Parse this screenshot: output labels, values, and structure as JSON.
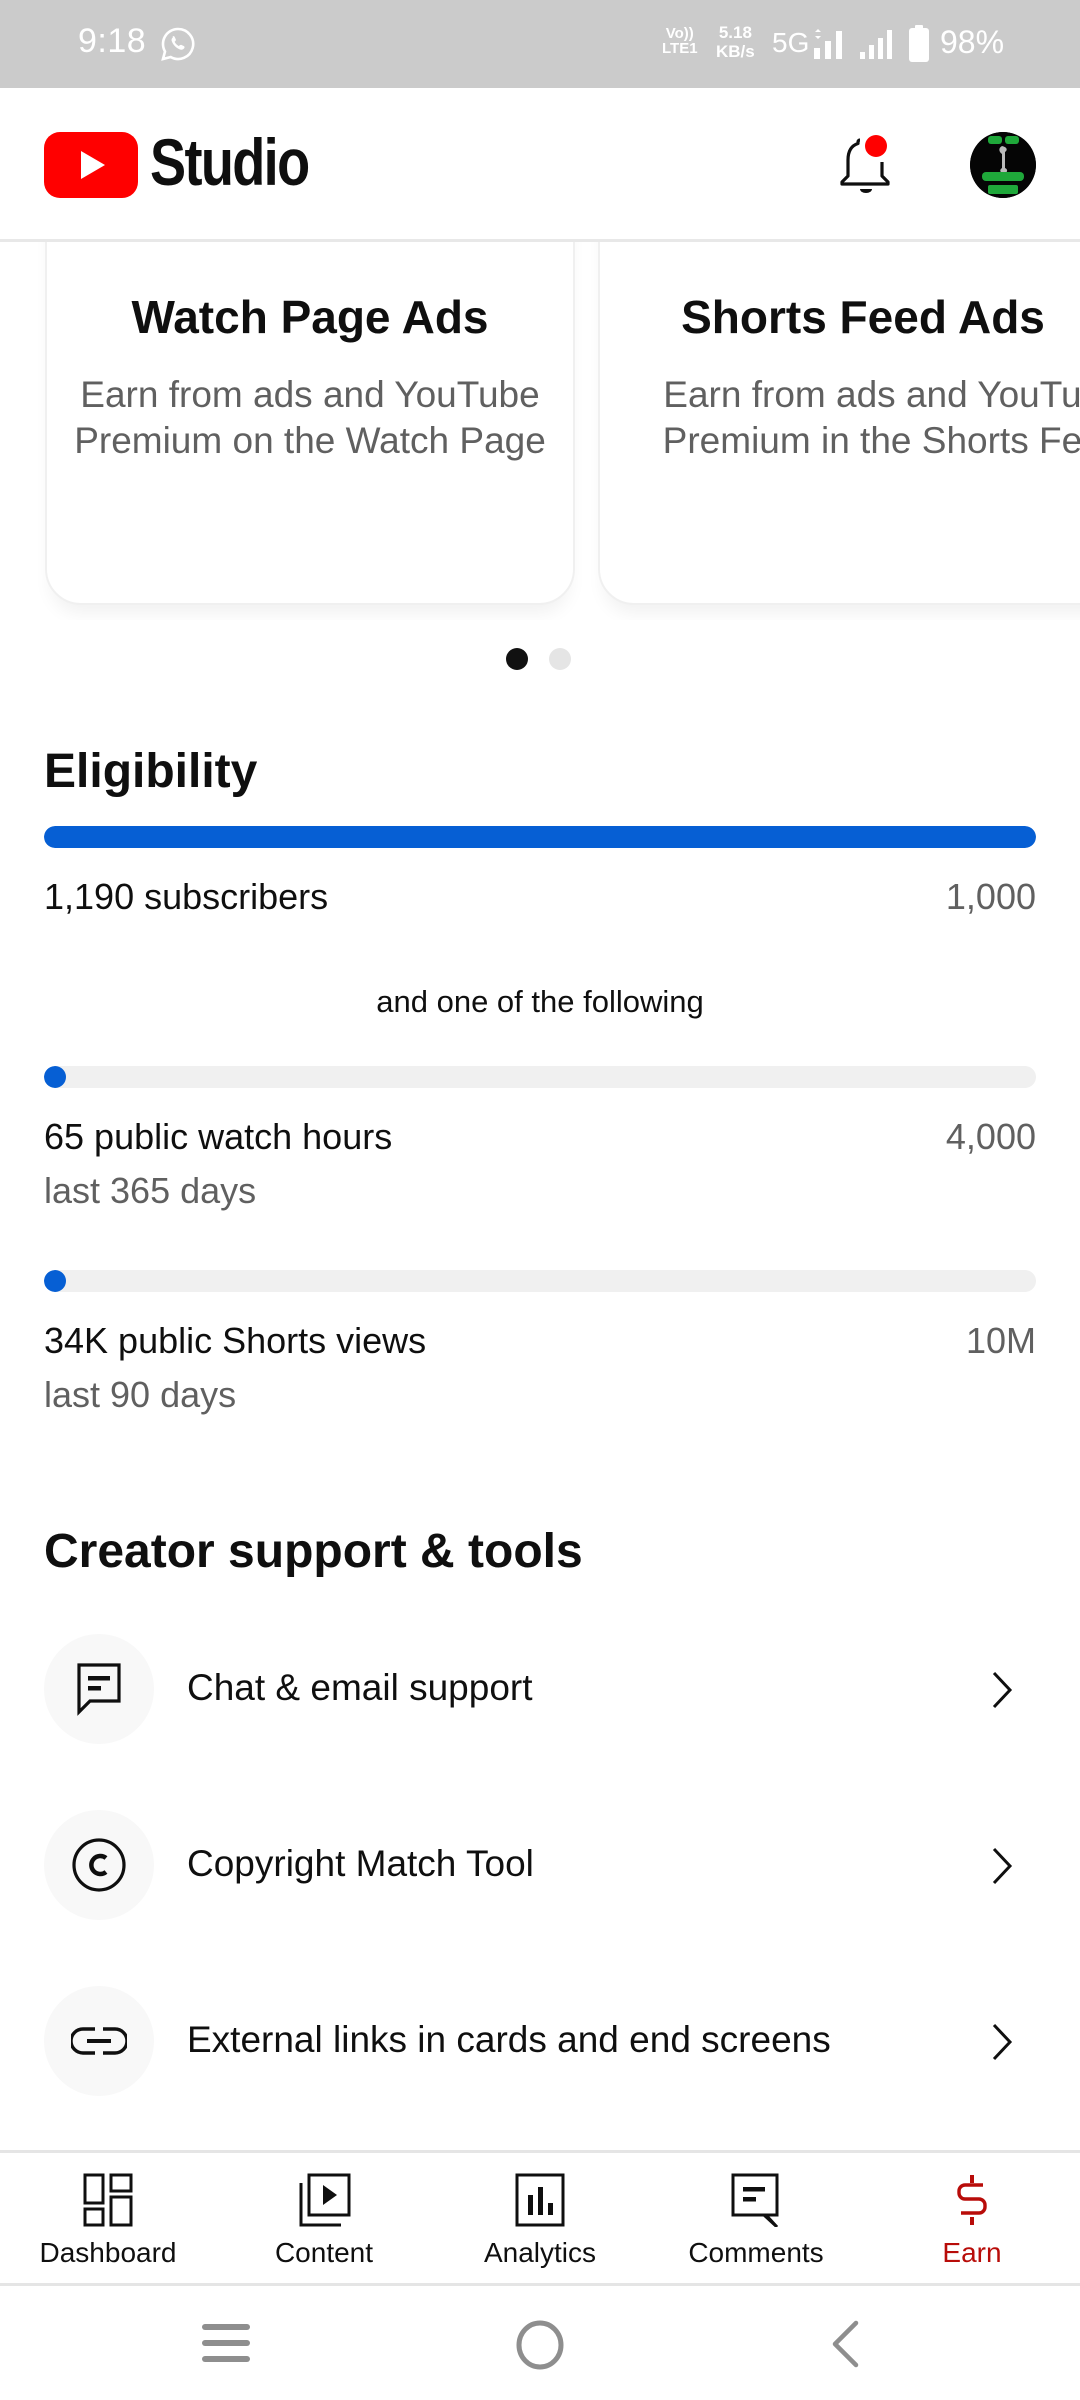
{
  "status_bar": {
    "time": "9:18",
    "notification_icon": "whatsapp-icon",
    "volte_line1": "Vo))",
    "volte_line2": "LTE1",
    "net_speed_value": "5.18",
    "net_speed_unit": "KB/s",
    "network_type": "5G",
    "battery_percent": "98%"
  },
  "header": {
    "app_name": "Studio",
    "logo": "youtube-logo",
    "notification_badge": true,
    "colors": {
      "brand_red": "#ff0000",
      "badge_red": "#ff0000"
    }
  },
  "monetization_cards": [
    {
      "title": "Watch Page Ads",
      "description": "Earn from ads and YouTube Premium on the Watch Page"
    },
    {
      "title": "Shorts Feed Ads",
      "description": "Earn from ads and YouTube Premium in the Shorts Feed"
    }
  ],
  "carousel": {
    "page_count": 2,
    "active_index": 0
  },
  "eligibility": {
    "title": "Eligibility",
    "accent_color": "#065fd4",
    "subscribers": {
      "label": "1,190 subscribers",
      "target": "1,000",
      "progress": 1.0
    },
    "separator": "and one of the following",
    "watch_hours": {
      "label": "65 public watch hours",
      "target": "4,000",
      "period": "last 365 days",
      "progress": 0.016
    },
    "shorts_views": {
      "label": "34K public Shorts views",
      "target": "10M",
      "period": "last 90 days",
      "progress": 0.0034
    }
  },
  "support": {
    "title": "Creator support & tools",
    "items": [
      {
        "label": "Chat & email support",
        "icon": "chat-support-icon"
      },
      {
        "label": "Copyright Match Tool",
        "icon": "copyright-icon"
      },
      {
        "label": "External links in cards and end screens",
        "icon": "link-icon"
      }
    ]
  },
  "bottom_nav": {
    "active_color": "#b80c09",
    "items": [
      {
        "label": "Dashboard",
        "icon": "dashboard-icon",
        "active": false
      },
      {
        "label": "Content",
        "icon": "content-icon",
        "active": false
      },
      {
        "label": "Analytics",
        "icon": "analytics-icon",
        "active": false
      },
      {
        "label": "Comments",
        "icon": "comments-icon",
        "active": false
      },
      {
        "label": "Earn",
        "icon": "dollar-icon",
        "active": true
      }
    ]
  }
}
